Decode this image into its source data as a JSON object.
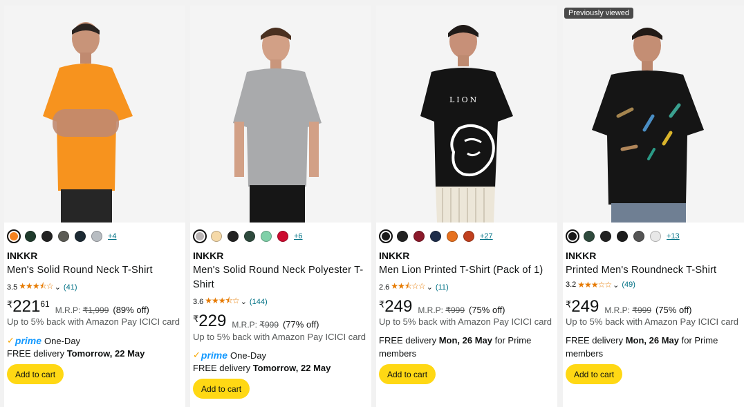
{
  "products": [
    {
      "badge": "",
      "swatches": [
        "#f5821f",
        "#1f3b2c",
        "#222222",
        "#5b5b55",
        "#1c2a33",
        "#b8bdc2"
      ],
      "more": "+4",
      "brand": "INKKR",
      "title": "Men's Solid Round Neck T-Shirt",
      "rating": "3.5",
      "reviews": "(41)",
      "currency": "₹",
      "price_whole": "221",
      "price_fraction": "61",
      "mrp_label": "M.R.P:",
      "mrp": "₹1,999",
      "discount": "(89% off)",
      "cashback": "Up to 5% back with Amazon Pay ICICI card",
      "prime_text": "prime",
      "prime_suffix": "One-Day",
      "delivery_prefix": "FREE delivery ",
      "delivery_bold": "Tomorrow, 22 May",
      "delivery_suffix": "",
      "button": "Add to cart",
      "shirt_color": "#f7931e"
    },
    {
      "badge": "",
      "swatches": [
        "#b9b4b4",
        "#f5d9a8",
        "#222222",
        "#2e4a3d",
        "#7fd0a8",
        "#cc0a2f"
      ],
      "more": "+6",
      "brand": "INKKR",
      "title": "Men's Solid Round Neck Polyester T-Shirt",
      "rating": "3.6",
      "reviews": "(144)",
      "currency": "₹",
      "price_whole": "229",
      "price_fraction": "",
      "mrp_label": "M.R.P:",
      "mrp": "₹999",
      "discount": "(77% off)",
      "cashback": "Up to 5% back with Amazon Pay ICICI card",
      "prime_text": "prime",
      "prime_suffix": "One-Day",
      "delivery_prefix": "FREE delivery ",
      "delivery_bold": "Tomorrow, 22 May",
      "delivery_suffix": "",
      "button": "Add to cart",
      "shirt_color": "#a9aaac"
    },
    {
      "badge": "",
      "swatches": [
        "#1a1a1a",
        "#222222",
        "#8b1a2b",
        "#1e2d4a",
        "#e6711f",
        "#c0401e"
      ],
      "more": "+27",
      "brand": "INKKR",
      "title": "Men Lion Printed T-Shirt (Pack of 1)",
      "rating": "2.6",
      "reviews": "(11)",
      "currency": "₹",
      "price_whole": "249",
      "price_fraction": "",
      "mrp_label": "M.R.P:",
      "mrp": "₹999",
      "discount": "(75% off)",
      "cashback": "Up to 5% back with Amazon Pay ICICI card",
      "prime_text": "",
      "prime_suffix": "",
      "delivery_prefix": "FREE delivery ",
      "delivery_bold": "Mon, 26 May",
      "delivery_suffix": " for Prime members",
      "button": "Add to cart",
      "shirt_color": "#141414",
      "print_text": "LION"
    },
    {
      "badge": "Previously viewed",
      "swatches": [
        "#1a1a1a",
        "#2f4a3d",
        "#222222",
        "#1d1d1d",
        "#555555",
        "#e8e8e8"
      ],
      "more": "+13",
      "brand": "INKKR",
      "title": "Printed Men's Roundneck T-Shirt",
      "rating": "3.2",
      "reviews": "(49)",
      "currency": "₹",
      "price_whole": "249",
      "price_fraction": "",
      "mrp_label": "M.R.P:",
      "mrp": "₹999",
      "discount": "(75% off)",
      "cashback": "Up to 5% back with Amazon Pay ICICI card",
      "prime_text": "",
      "prime_suffix": "",
      "delivery_prefix": "FREE delivery ",
      "delivery_bold": "Mon, 26 May",
      "delivery_suffix": " for Prime members",
      "button": "Add to cart",
      "shirt_color": "#151515"
    }
  ]
}
